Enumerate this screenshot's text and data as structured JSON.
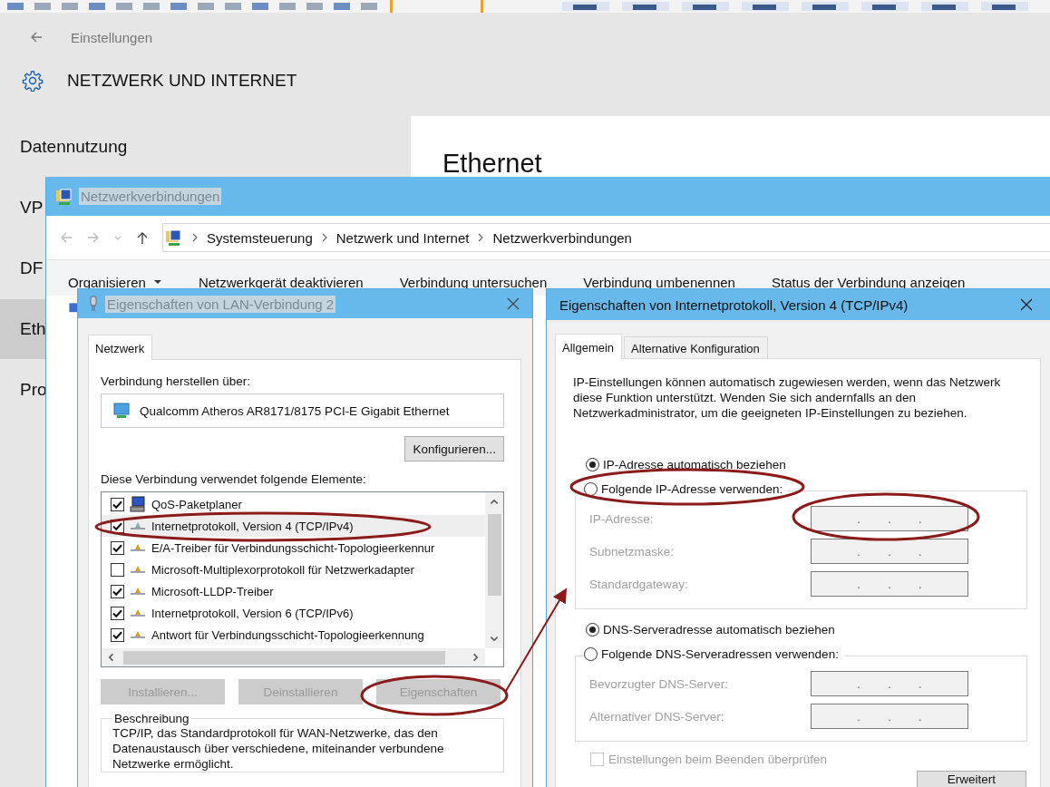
{
  "settings": {
    "title": "Einstellungen",
    "header": "NETZWERK UND INTERNET",
    "heading": "Ethernet",
    "nav": [
      {
        "label": "Datennutzung",
        "selected": false
      },
      {
        "label": "VP",
        "selected": false
      },
      {
        "label": "DF",
        "selected": false
      },
      {
        "label": "Eth",
        "selected": true
      },
      {
        "label": "Pro",
        "selected": false
      }
    ]
  },
  "explorer": {
    "title": "Netzwerkverbindungen",
    "title_highlighted": true,
    "breadcrumb": [
      "Systemsteuerung",
      "Netzwerk und Internet",
      "Netzwerkverbindungen"
    ],
    "commands": [
      {
        "label": "Organisieren",
        "dropdown": true
      },
      {
        "label": "Netzwerkgerät deaktivieren",
        "dropdown": false
      },
      {
        "label": "Verbindung untersuchen",
        "dropdown": false
      },
      {
        "label": "Verbindung umbenennen",
        "dropdown": false
      },
      {
        "label": "Status der Verbindung anzeigen",
        "dropdown": false
      }
    ]
  },
  "lan_dialog": {
    "title": "Eigenschaften von LAN-Verbindung 2",
    "title_highlighted": true,
    "tabs": [
      {
        "label": "Netzwerk",
        "selected": true
      }
    ],
    "connect_label": "Verbindung herstellen über:",
    "adapter": "Qualcomm Atheros AR8171/8175 PCI-E Gigabit Ethernet",
    "configure_button": "Konfigurieren...",
    "items_label": "Diese Verbindung verwendet folgende Elemente:",
    "items": [
      {
        "label": "QoS-Paketplaner",
        "kind": "service",
        "checked": true,
        "selected": false
      },
      {
        "label": "Internetprotokoll, Version 4 (TCP/IPv4)",
        "kind": "protocol",
        "checked": true,
        "selected": true
      },
      {
        "label": "E/A-Treiber für Verbindungsschicht-Topologieerkennur",
        "kind": "protocol",
        "checked": true,
        "selected": false
      },
      {
        "label": "Microsoft-Multiplexorprotokoll für Netzwerkadapter",
        "kind": "protocol",
        "checked": false,
        "selected": false
      },
      {
        "label": "Microsoft-LLDP-Treiber",
        "kind": "protocol",
        "checked": true,
        "selected": false
      },
      {
        "label": "Internetprotokoll, Version 6 (TCP/IPv6)",
        "kind": "protocol",
        "checked": true,
        "selected": false
      },
      {
        "label": "Antwort für Verbindungsschicht-Topologieerkennung",
        "kind": "protocol",
        "checked": true,
        "selected": false
      }
    ],
    "buttons": [
      {
        "label": "Installieren...",
        "disabled": true
      },
      {
        "label": "Deinstallieren",
        "disabled": true
      },
      {
        "label": "Eigenschaften",
        "disabled": true
      }
    ],
    "description_title": "Beschreibung",
    "description": "TCP/IP, das Standardprotokoll für WAN-Netzwerke, das den Datenaustausch über verschiedene, miteinander verbundene Netzwerke ermöglicht."
  },
  "ipv4_dialog": {
    "title": "Eigenschaften von Internetprotokoll, Version 4 (TCP/IPv4)",
    "tabs": [
      {
        "label": "Allgemein",
        "selected": true
      },
      {
        "label": "Alternative Konfiguration",
        "selected": false
      }
    ],
    "intro": "IP-Einstellungen können automatisch zugewiesen werden, wenn das Netzwerk diese Funktion unterstützt. Wenden Sie sich andernfalls an den Netzwerkadministrator, um die geeigneten IP-Einstellungen zu beziehen.",
    "ip_options": [
      {
        "label": "IP-Adresse automatisch beziehen",
        "selected": true
      },
      {
        "label": "Folgende IP-Adresse verwenden:",
        "selected": false
      }
    ],
    "ip_fields": [
      {
        "label": "IP-Adresse:",
        "parts": [
          ".",
          ".",
          "."
        ],
        "disabled": true
      },
      {
        "label": "Subnetzmaske:",
        "parts": [
          ".",
          ".",
          "."
        ],
        "disabled": true
      },
      {
        "label": "Standardgateway:",
        "parts": [
          ".",
          ".",
          "."
        ],
        "disabled": true
      }
    ],
    "dns_options": [
      {
        "label": "DNS-Serveradresse automatisch beziehen",
        "selected": true
      },
      {
        "label": "Folgende DNS-Serveradressen verwenden:",
        "selected": false
      }
    ],
    "dns_fields": [
      {
        "label": "Bevorzugter DNS-Server:",
        "parts": [
          ".",
          ".",
          "."
        ],
        "disabled": true
      },
      {
        "label": "Alternativer DNS-Server:",
        "parts": [
          ".",
          ".",
          "."
        ],
        "disabled": true
      }
    ],
    "validate": {
      "label": "Einstellungen beim Beenden überprüfen",
      "checked": false,
      "disabled": true
    },
    "advanced_button": "Erweitert"
  }
}
